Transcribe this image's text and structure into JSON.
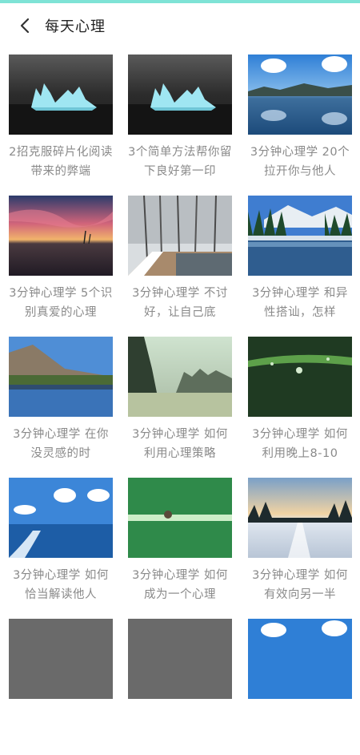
{
  "header": {
    "title": "每天心理",
    "back_icon": "chevron-left-icon"
  },
  "articles": [
    {
      "caption": "2招克服碎片化阅读带来的弊端",
      "image": "iceberg"
    },
    {
      "caption": "3个简单方法帮你留下良好第一印",
      "image": "iceberg"
    },
    {
      "caption": "3分钟心理学 20个拉开你与他人",
      "image": "lake-clouds"
    },
    {
      "caption": "3分钟心理学 5个识别真爱的心理",
      "image": "sunset-sea"
    },
    {
      "caption": "3分钟心理学 不讨好，让自己底",
      "image": "snow-forest"
    },
    {
      "caption": "3分钟心理学 和异性搭讪，怎样",
      "image": "mountain-lake"
    },
    {
      "caption": "3分钟心理学 在你没灵感的时",
      "image": "lake-hills"
    },
    {
      "caption": "3分钟心理学 如何利用心理策略",
      "image": "karst-bay"
    },
    {
      "caption": "3分钟心理学 如何利用晚上8-10",
      "image": "dew-grass"
    },
    {
      "caption": "3分钟心理学 如何恰当解读他人",
      "image": "ocean-wake"
    },
    {
      "caption": "3分钟心理学 如何成为一个心理",
      "image": "green-rope"
    },
    {
      "caption": "3分钟心理学 如何有效向另一半",
      "image": "snow-sunrise"
    },
    {
      "caption": "",
      "image": "gray"
    },
    {
      "caption": "",
      "image": "gray"
    },
    {
      "caption": "",
      "image": "blue-sky"
    }
  ]
}
